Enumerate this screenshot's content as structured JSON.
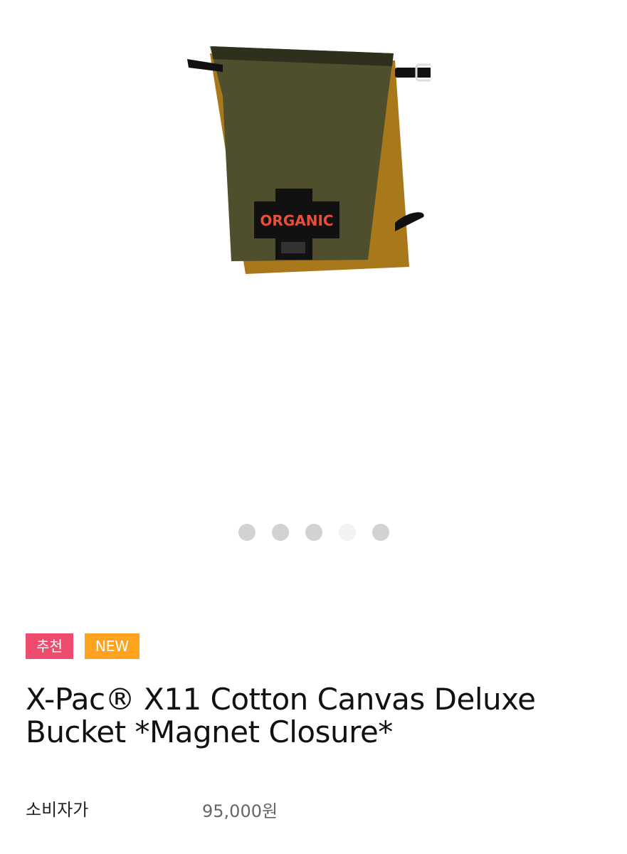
{
  "carousel": {
    "dots": 5,
    "active_index": 3
  },
  "product": {
    "image_label": "ORGANIC",
    "badges": [
      {
        "label": "추천",
        "color": "#ee4c6e"
      },
      {
        "label": "NEW",
        "color": "#ffa21d"
      }
    ],
    "title": "X-Pac® X11 Cotton Canvas Deluxe Bucket *Magnet Closure*",
    "price": {
      "label": "소비자가",
      "value": "95,000원"
    }
  }
}
